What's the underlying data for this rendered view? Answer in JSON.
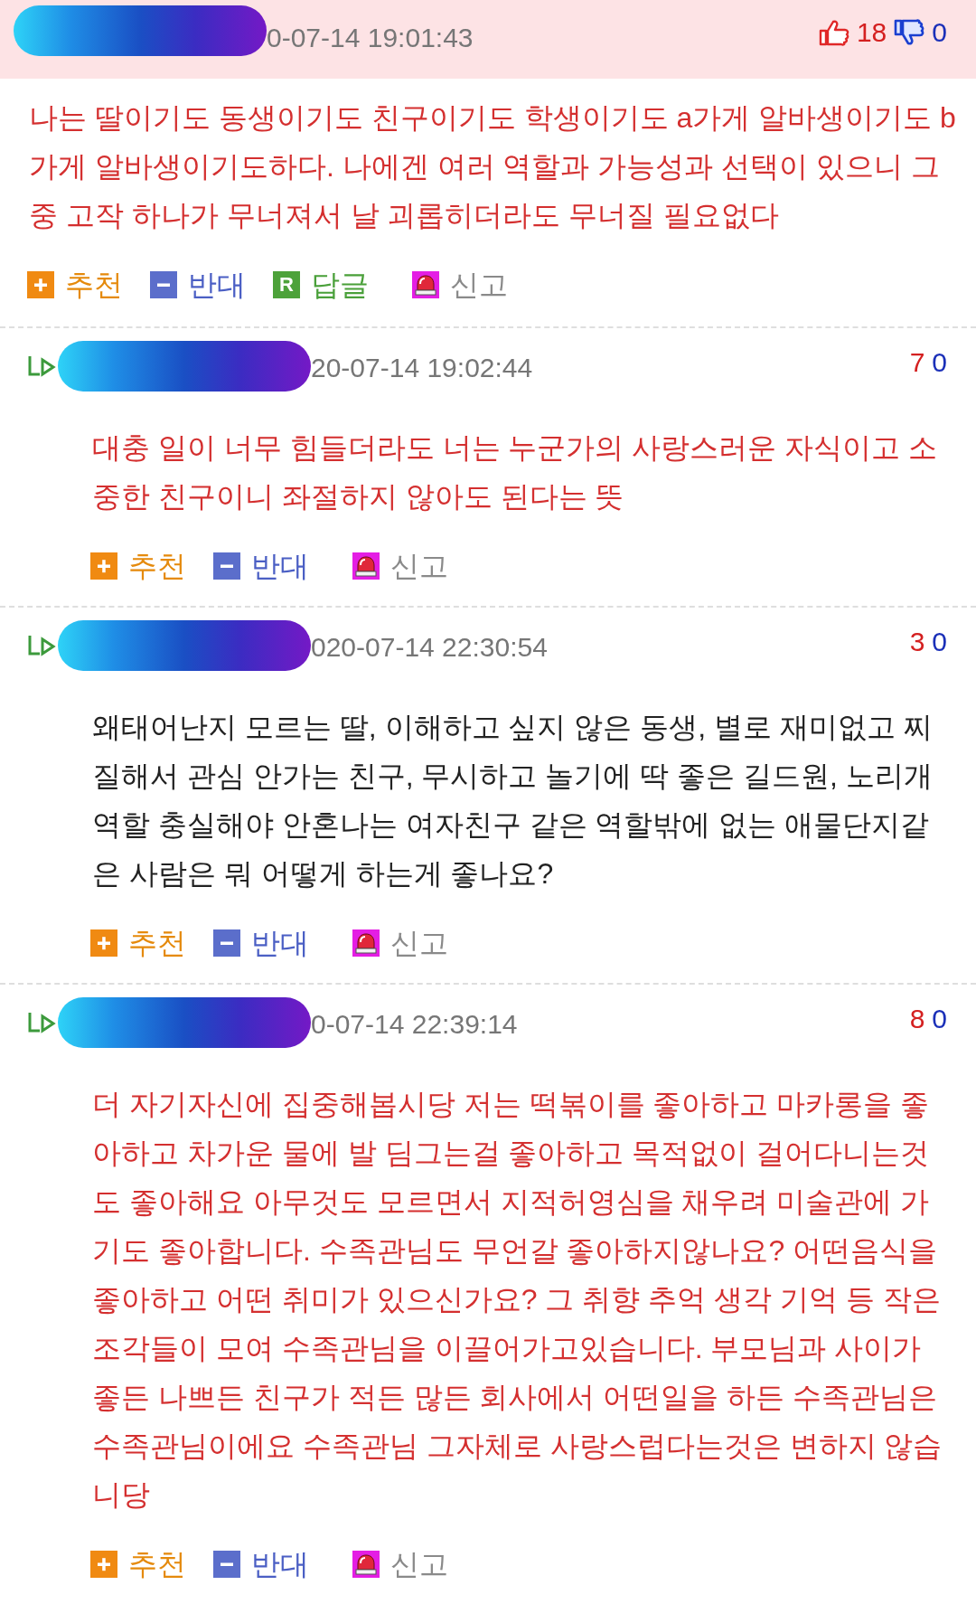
{
  "comments": [
    {
      "kind": "comment",
      "date": "0-07-14 19:01:43",
      "up": "18",
      "down": "0",
      "color": "#d42f2f",
      "text": "나는 딸이기도 동생이기도 친구이기도 학생이기도 a가게 알바생이기도 b가게 알바생이기도하다. 나에겐 여러 역할과 가능성과 선택이 있으니 그 중 고작 하나가 무너져서 날 괴롭히더라도 무너질 필요없다",
      "actions": [
        {
          "kind": "recommend",
          "label": "추천"
        },
        {
          "kind": "oppose",
          "label": "반대"
        },
        {
          "kind": "reply",
          "badge": "R",
          "label": "답글"
        },
        {
          "kind": "report",
          "label": "신고"
        }
      ]
    },
    {
      "kind": "reply",
      "date": "20-07-14 19:02:44",
      "up": "7",
      "down": "0",
      "color": "#d42f2f",
      "text": "대충 일이 너무 힘들더라도 너는 누군가의 사랑스러운 자식이고 소중한 친구이니 좌절하지 않아도 된다는 뜻",
      "actions": [
        {
          "kind": "recommend",
          "label": "추천"
        },
        {
          "kind": "oppose",
          "label": "반대"
        },
        {
          "kind": "report",
          "label": "신고"
        }
      ]
    },
    {
      "kind": "reply",
      "date": "020-07-14 22:30:54",
      "up": "3",
      "down": "0",
      "color": "#222222",
      "text": "왜태어난지 모르는 딸, 이해하고 싶지 않은 동생, 별로 재미없고 찌질해서 관심 안가는 친구, 무시하고 놀기에 딱 좋은 길드원, 노리개 역할 충실해야 안혼나는 여자친구 같은 역할밖에 없는 애물단지같은 사람은 뭐 어떻게 하는게 좋나요?",
      "actions": [
        {
          "kind": "recommend",
          "label": "추천"
        },
        {
          "kind": "oppose",
          "label": "반대"
        },
        {
          "kind": "report",
          "label": "신고"
        }
      ]
    },
    {
      "kind": "reply",
      "date": "0-07-14 22:39:14",
      "up": "8",
      "down": "0",
      "color": "#d42f2f",
      "text": "더 자기자신에 집중해봅시당 저는 떡볶이를 좋아하고 마카롱을 좋아하고 차가운 물에 발 딤그는걸 좋아하고 목적없이 걸어다니는것도 좋아해요 아무것도 모르면서 지적허영심을 채우려 미술관에 가기도 좋아합니다. 수족관님도 무언갈 좋아하지않나요? 어떤음식을 좋아하고 어떤 취미가 있으신가요? 그 취향 추억 생각 기억 등 작은 조각들이 모여 수족관님을 이끌어가고있습니다. 부모님과 사이가 좋든 나쁘든 친구가 적든 많든 회사에서 어떤일을 하든 수족관님은 수족관님이에요 수족관님 그자체로 사랑스럽다는것은 변하지 않습니당",
      "actions": [
        {
          "kind": "recommend",
          "label": "추천"
        },
        {
          "kind": "oppose",
          "label": "반대"
        },
        {
          "kind": "report",
          "label": "신고"
        }
      ]
    }
  ]
}
